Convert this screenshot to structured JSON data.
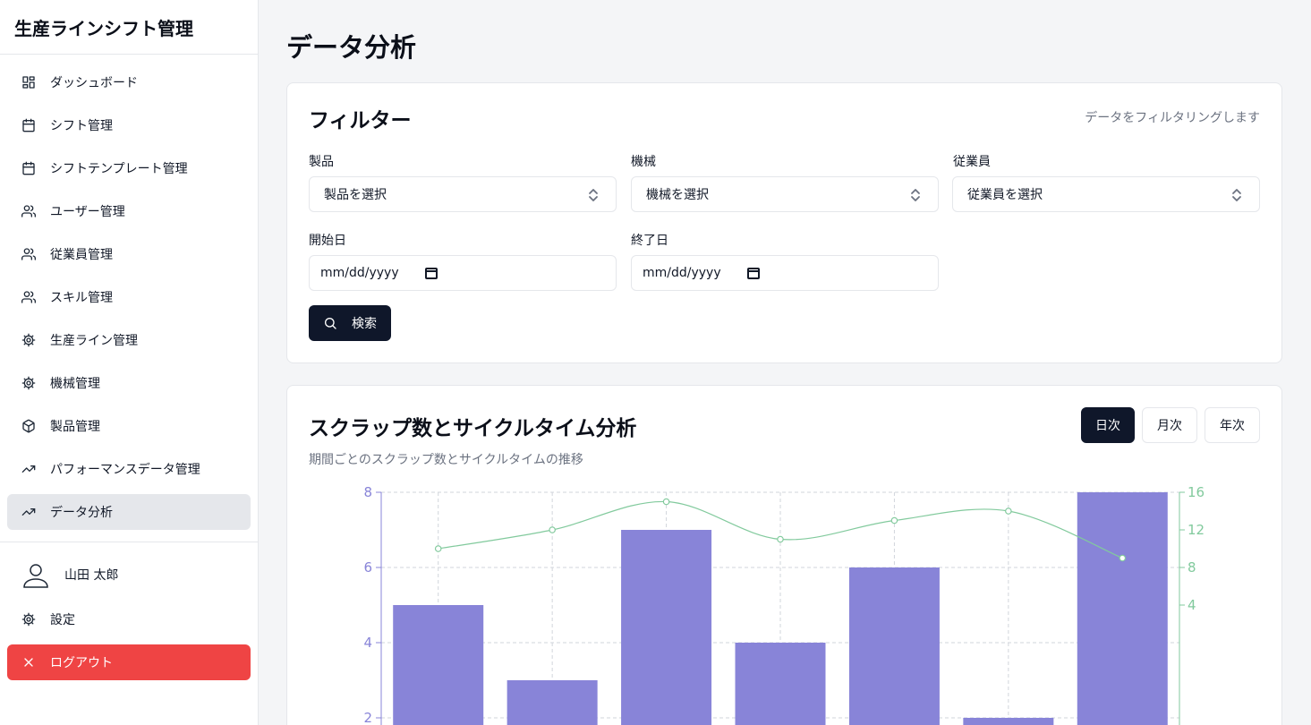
{
  "app": {
    "title": "生産ラインシフト管理"
  },
  "sidebar": {
    "items": [
      {
        "label": "ダッシュボード",
        "icon": "dashboard-icon"
      },
      {
        "label": "シフト管理",
        "icon": "calendar-icon"
      },
      {
        "label": "シフトテンプレート管理",
        "icon": "calendar-icon"
      },
      {
        "label": "ユーザー管理",
        "icon": "users-icon"
      },
      {
        "label": "従業員管理",
        "icon": "users-icon"
      },
      {
        "label": "スキル管理",
        "icon": "users-icon"
      },
      {
        "label": "生産ライン管理",
        "icon": "gear-icon"
      },
      {
        "label": "機械管理",
        "icon": "gear-icon"
      },
      {
        "label": "製品管理",
        "icon": "package-icon"
      },
      {
        "label": "パフォーマンスデータ管理",
        "icon": "trending-up-icon"
      },
      {
        "label": "データ分析",
        "icon": "trending-up-icon",
        "active": true
      }
    ],
    "user": {
      "name": "山田 太郎"
    },
    "settings_label": "設定",
    "logout_label": "ログアウト"
  },
  "page": {
    "title": "データ分析"
  },
  "filter": {
    "title": "フィルター",
    "description": "データをフィルタリングします",
    "product": {
      "label": "製品",
      "placeholder": "製品を選択"
    },
    "machine": {
      "label": "機械",
      "placeholder": "機械を選択"
    },
    "employee": {
      "label": "従業員",
      "placeholder": "従業員を選択"
    },
    "start_date": {
      "label": "開始日",
      "value": "mm/dd/yyyy"
    },
    "end_date": {
      "label": "終了日",
      "value": "mm/dd/yyyy"
    },
    "search_label": "検索"
  },
  "chart_section": {
    "title": "スクラップ数とサイクルタイム分析",
    "description": "期間ごとのスクラップ数とサイクルタイムの推移",
    "periods": [
      {
        "label": "日次",
        "active": true
      },
      {
        "label": "月次",
        "active": false
      },
      {
        "label": "年次",
        "active": false
      }
    ]
  },
  "colors": {
    "bar": "#8884d8",
    "line": "#82ca9d",
    "logout": "#ef4444",
    "primary": "#0f172a"
  },
  "chart_data": {
    "type": "bar",
    "grid": true,
    "series": [
      {
        "type": "bar",
        "axis": "left",
        "values": [
          5,
          3,
          7,
          4,
          6,
          2,
          8
        ]
      },
      {
        "type": "line",
        "axis": "right",
        "values": [
          10,
          12,
          15,
          11,
          13,
          14,
          9
        ]
      }
    ],
    "y_left": {
      "ticks": [
        2,
        4,
        6,
        8
      ],
      "visible_range": [
        1.3,
        8
      ]
    },
    "y_right": {
      "ticks": [
        4,
        8,
        12,
        16
      ],
      "visible_range": [
        2.6,
        16
      ]
    }
  }
}
